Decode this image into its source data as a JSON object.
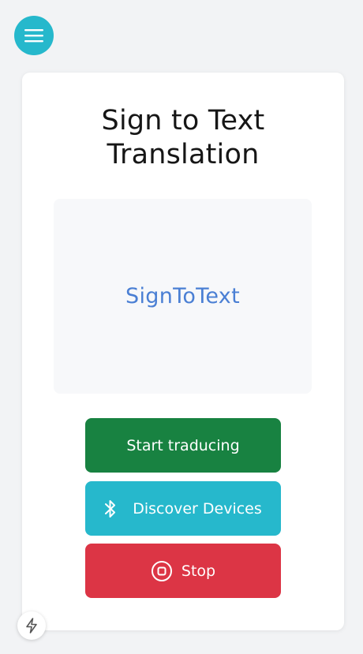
{
  "header": {
    "menu_icon": "hamburger-menu-icon",
    "menu_button_color": "#26b8cc"
  },
  "card": {
    "title": "Sign to Text Translation",
    "video_label": "SignToText"
  },
  "buttons": {
    "start": {
      "label": "Start traducing",
      "color": "#188241"
    },
    "discover": {
      "label": "Discover Devices",
      "icon": "bluetooth-icon",
      "color": "#26b8cc"
    },
    "stop": {
      "label": "Stop",
      "icon": "stop-circle-icon",
      "color": "#dc3545"
    }
  },
  "footer": {
    "floating_icon": "lightning-bolt-icon"
  }
}
